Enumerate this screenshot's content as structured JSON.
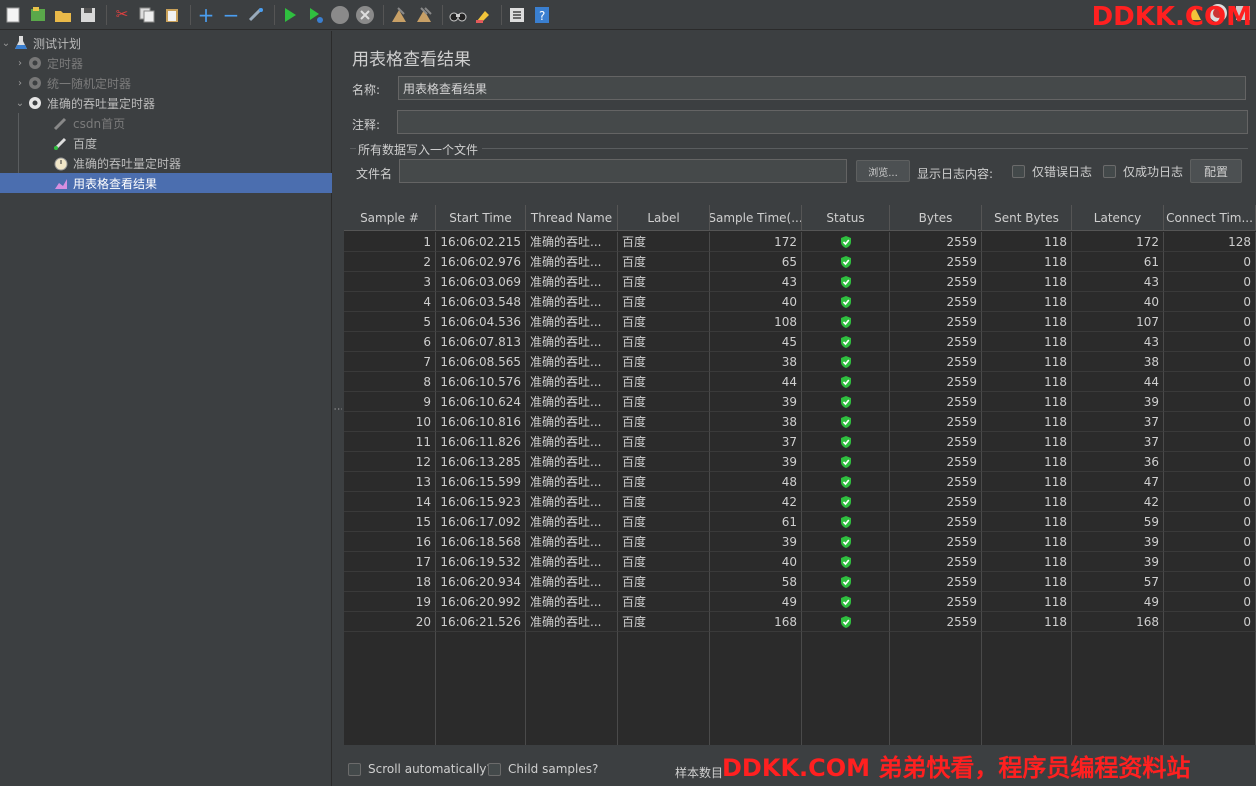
{
  "toolbar": {
    "icons": [
      "new-icon",
      "templates-icon",
      "open-icon",
      "save-icon",
      "cut-icon",
      "copy-icon",
      "paste-icon",
      "expand-icon",
      "collapse-icon",
      "toggle-icon",
      "start-icon",
      "start-no-pause-icon",
      "stop-icon",
      "shutdown-icon",
      "clear-icon",
      "clear-all-icon",
      "search-icon",
      "reset-search-icon",
      "function-helper-icon",
      "help-icon"
    ],
    "watermark": "DDKK.COM"
  },
  "tree": {
    "items": [
      {
        "label": "测试计划",
        "icon": "flask-icon",
        "state": "normal"
      },
      {
        "label": "定时器",
        "icon": "gear-icon",
        "state": "disabled"
      },
      {
        "label": "统一随机定时器",
        "icon": "gear-icon",
        "state": "disabled"
      },
      {
        "label": "准确的吞吐量定时器",
        "icon": "gear-icon",
        "state": "normal"
      },
      {
        "label": "csdn首页",
        "icon": "pipette-icon",
        "state": "disabled"
      },
      {
        "label": "百度",
        "icon": "pipette-icon",
        "state": "normal"
      },
      {
        "label": "准确的吞吐量定时器",
        "icon": "stopwatch-icon",
        "state": "normal"
      },
      {
        "label": "用表格查看结果",
        "icon": "chart-icon",
        "state": "selected"
      }
    ]
  },
  "panel": {
    "title": "用表格查看结果",
    "name_label": "名称:",
    "name_value": "用表格查看结果",
    "comment_label": "注释:",
    "comment_value": "",
    "fieldset_title": "所有数据写入一个文件",
    "filename_label": "文件名",
    "filename_value": "",
    "browse_label": "浏览...",
    "log_content_label": "显示日志内容:",
    "errors_only_label": "仅错误日志",
    "success_only_label": "仅成功日志",
    "configure_label": "配置"
  },
  "table": {
    "columns": [
      "Sample #",
      "Start Time",
      "Thread Name",
      "Label",
      "Sample Time(...",
      "Status",
      "Bytes",
      "Sent Bytes",
      "Latency",
      "Connect Tim..."
    ],
    "rows": [
      [
        "1",
        "16:06:02.215",
        "准确的吞吐...",
        "百度",
        "172",
        "ok",
        "2559",
        "118",
        "172",
        "128"
      ],
      [
        "2",
        "16:06:02.976",
        "准确的吞吐...",
        "百度",
        "65",
        "ok",
        "2559",
        "118",
        "61",
        "0"
      ],
      [
        "3",
        "16:06:03.069",
        "准确的吞吐...",
        "百度",
        "43",
        "ok",
        "2559",
        "118",
        "43",
        "0"
      ],
      [
        "4",
        "16:06:03.548",
        "准确的吞吐...",
        "百度",
        "40",
        "ok",
        "2559",
        "118",
        "40",
        "0"
      ],
      [
        "5",
        "16:06:04.536",
        "准确的吞吐...",
        "百度",
        "108",
        "ok",
        "2559",
        "118",
        "107",
        "0"
      ],
      [
        "6",
        "16:06:07.813",
        "准确的吞吐...",
        "百度",
        "45",
        "ok",
        "2559",
        "118",
        "43",
        "0"
      ],
      [
        "7",
        "16:06:08.565",
        "准确的吞吐...",
        "百度",
        "38",
        "ok",
        "2559",
        "118",
        "38",
        "0"
      ],
      [
        "8",
        "16:06:10.576",
        "准确的吞吐...",
        "百度",
        "44",
        "ok",
        "2559",
        "118",
        "44",
        "0"
      ],
      [
        "9",
        "16:06:10.624",
        "准确的吞吐...",
        "百度",
        "39",
        "ok",
        "2559",
        "118",
        "39",
        "0"
      ],
      [
        "10",
        "16:06:10.816",
        "准确的吞吐...",
        "百度",
        "38",
        "ok",
        "2559",
        "118",
        "37",
        "0"
      ],
      [
        "11",
        "16:06:11.826",
        "准确的吞吐...",
        "百度",
        "37",
        "ok",
        "2559",
        "118",
        "37",
        "0"
      ],
      [
        "12",
        "16:06:13.285",
        "准确的吞吐...",
        "百度",
        "39",
        "ok",
        "2559",
        "118",
        "36",
        "0"
      ],
      [
        "13",
        "16:06:15.599",
        "准确的吞吐...",
        "百度",
        "48",
        "ok",
        "2559",
        "118",
        "47",
        "0"
      ],
      [
        "14",
        "16:06:15.923",
        "准确的吞吐...",
        "百度",
        "42",
        "ok",
        "2559",
        "118",
        "42",
        "0"
      ],
      [
        "15",
        "16:06:17.092",
        "准确的吞吐...",
        "百度",
        "61",
        "ok",
        "2559",
        "118",
        "59",
        "0"
      ],
      [
        "16",
        "16:06:18.568",
        "准确的吞吐...",
        "百度",
        "39",
        "ok",
        "2559",
        "118",
        "39",
        "0"
      ],
      [
        "17",
        "16:06:19.532",
        "准确的吞吐...",
        "百度",
        "40",
        "ok",
        "2559",
        "118",
        "39",
        "0"
      ],
      [
        "18",
        "16:06:20.934",
        "准确的吞吐...",
        "百度",
        "58",
        "ok",
        "2559",
        "118",
        "57",
        "0"
      ],
      [
        "19",
        "16:06:20.992",
        "准确的吞吐...",
        "百度",
        "49",
        "ok",
        "2559",
        "118",
        "49",
        "0"
      ],
      [
        "20",
        "16:06:21.526",
        "准确的吞吐...",
        "百度",
        "168",
        "ok",
        "2559",
        "118",
        "168",
        "0"
      ]
    ]
  },
  "bottom": {
    "scroll_label": "Scroll automatically?",
    "child_label": "Child samples?",
    "sample_count_label": "样本数目",
    "watermark": "DDKK.COM 弟弟快看，程序员编程资料站"
  },
  "colors": {
    "background": "#3c3f41",
    "table_bg": "#2b2b2b",
    "selection": "#4b6eaf",
    "status_ok": "#2fbf3f",
    "watermark": "#ff2020"
  }
}
